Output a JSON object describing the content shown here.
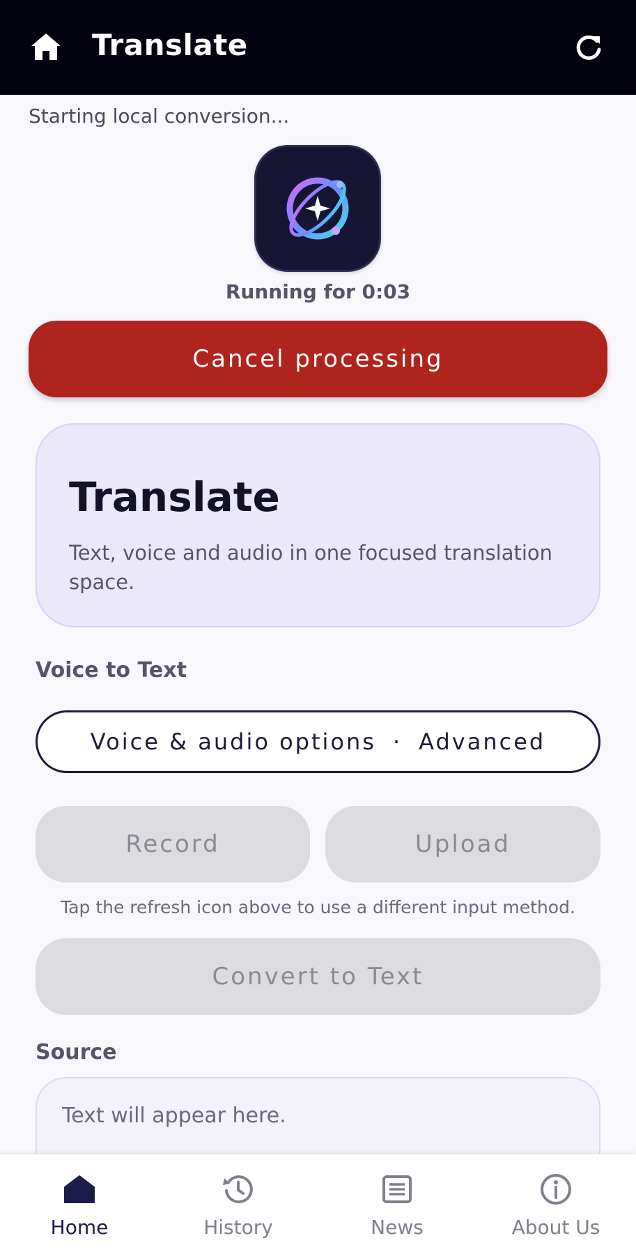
{
  "header": {
    "title": "Translate"
  },
  "status": {
    "message": "Starting local conversion...",
    "running": "Running for 0:03",
    "cancel_label": "Cancel processing"
  },
  "hero": {
    "title": "Translate",
    "subtitle": "Text, voice and audio in one focused translation space."
  },
  "voice": {
    "section_label": "Voice to Text",
    "options_label": "Voice & audio options",
    "options_separator": "·",
    "options_mode": "Advanced",
    "record_label": "Record",
    "upload_label": "Upload",
    "hint": "Tap the refresh icon above to use a different input method.",
    "convert_label": "Convert to Text"
  },
  "source": {
    "section_label": "Source",
    "placeholder": "Text will appear here."
  },
  "nav": {
    "items": [
      {
        "label": "Home",
        "icon": "home-icon",
        "active": true
      },
      {
        "label": "History",
        "icon": "history-icon",
        "active": false
      },
      {
        "label": "News",
        "icon": "news-icon",
        "active": false
      },
      {
        "label": "About Us",
        "icon": "info-icon",
        "active": false
      }
    ]
  },
  "colors": {
    "header_bg": "#03030f",
    "cancel_bg": "#b0241e",
    "hero_bg": "#ece8fb",
    "disabled_bg": "#dcdce0",
    "accent": "#1c1c4a"
  }
}
